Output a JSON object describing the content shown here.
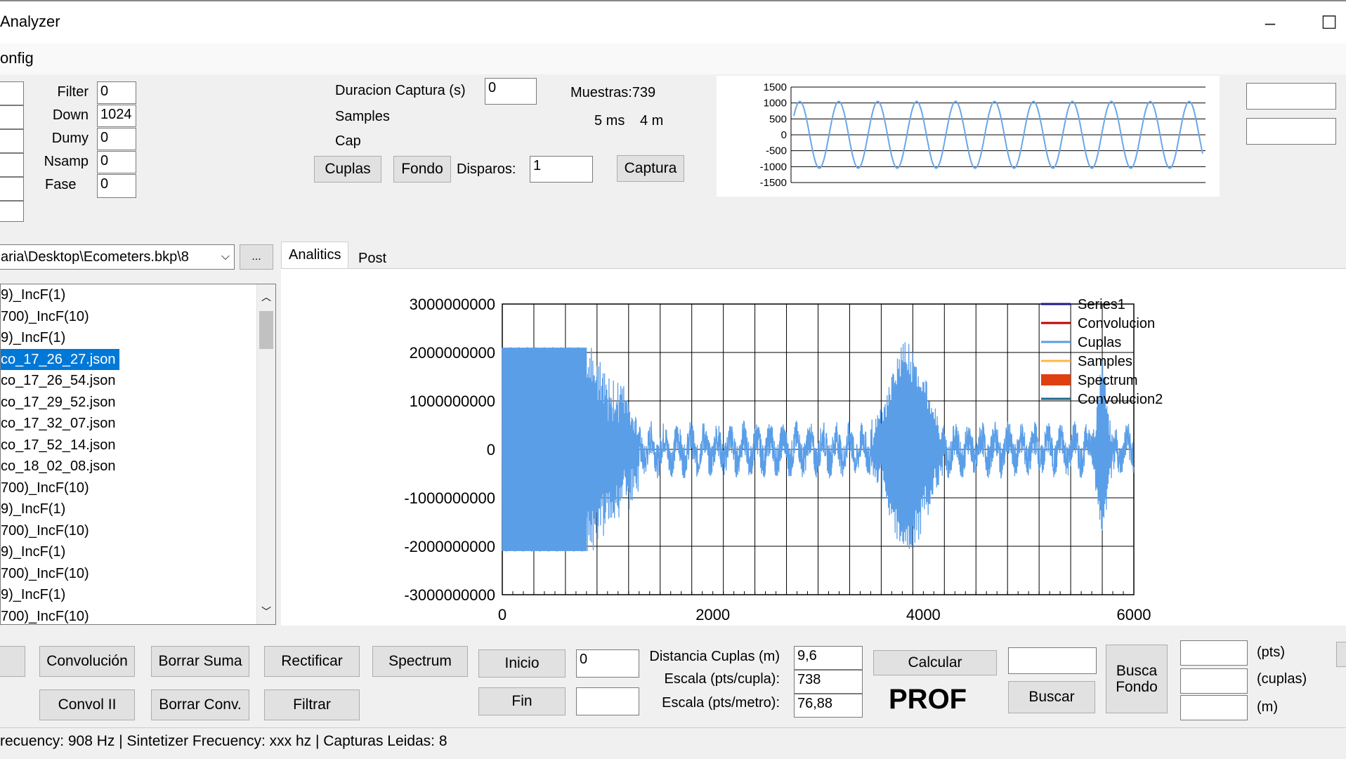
{
  "window": {
    "title": "Analyzer",
    "minimize": "–",
    "maximize": "☐"
  },
  "menu": {
    "config": "onfig"
  },
  "params": {
    "filter_label": "Filter",
    "filter": "0",
    "down_label": "Down",
    "down": "1024",
    "dumy_label": "Dumy",
    "dumy": "0",
    "nsamp_label": "Nsamp",
    "nsamp": "0",
    "fase_label": "Fase",
    "fase": "0"
  },
  "capture": {
    "duracion_label": "Duracion Captura  (s)",
    "duracion": "0",
    "samples_label": "Samples",
    "cap_label": "Cap",
    "muestras": "Muestras:739",
    "ms": "5 ms",
    "m": "4 m",
    "cuplas_btn": "Cuplas",
    "fondo_btn": "Fondo",
    "disparos_label": "Disparos:",
    "disparos": "1",
    "captura_btn": "Captura"
  },
  "mini_chart": {
    "ticks": [
      "1500",
      "1000",
      "500",
      "0",
      "-500",
      "-1000",
      "-1500"
    ],
    "color": "#6aa7e8"
  },
  "files": {
    "path": "aria\\Desktop\\Ecometers.bkp\\8",
    "browse": "...",
    "items": [
      "9)_IncF(1)",
      "700)_IncF(10)",
      "9)_IncF(1)",
      "co_17_26_27.json",
      "co_17_26_54.json",
      "co_17_29_52.json",
      "co_17_32_07.json",
      "co_17_52_14.json",
      "co_18_02_08.json",
      "700)_IncF(10)",
      "9)_IncF(1)",
      "700)_IncF(10)",
      "9)_IncF(1)",
      "700)_IncF(10)",
      "9)_IncF(1)",
      "700)_IncF(10)"
    ],
    "selected_index": 3
  },
  "tabs": {
    "analitics": "Analitics",
    "post": "Post"
  },
  "chart_data": {
    "type": "line",
    "x_ticks": [
      "0",
      "2000",
      "4000",
      "6000"
    ],
    "y_ticks": [
      "3000000000",
      "2000000000",
      "1000000000",
      "0",
      "-1000000000",
      "-2000000000",
      "-3000000000"
    ],
    "xlim": [
      0,
      6000
    ],
    "ylim": [
      -3000000000,
      3000000000
    ],
    "grid": true,
    "legend_position": "right",
    "legend": [
      {
        "name": "Series1",
        "color": "#1a1a8c",
        "kind": "line"
      },
      {
        "name": "Convolucion",
        "color": "#c00000",
        "kind": "line"
      },
      {
        "name": "Cuplas",
        "color": "#5a9ee8",
        "kind": "line"
      },
      {
        "name": "Samples",
        "color": "#ffb740",
        "kind": "line"
      },
      {
        "name": "Spectrum",
        "color": "#e04010",
        "kind": "box"
      },
      {
        "name": "Convolucion2",
        "color": "#1a6a8c",
        "kind": "line"
      }
    ]
  },
  "buttons": {
    "convolucion": "Convolución",
    "borrar_suma": "Borrar Suma",
    "rectificar": "Rectificar",
    "spectrum": "Spectrum",
    "convol_ii": "Convol II",
    "borrar_conv": "Borrar Conv.",
    "filtrar": "Filtrar",
    "inicio": "Inicio",
    "fin": "Fin",
    "calcular": "Calcular",
    "buscar": "Buscar",
    "busca_fondo": "Busca Fondo"
  },
  "inputs": {
    "inicio": "0",
    "fin": ""
  },
  "distances": {
    "distancia_label": "Distancia Cuplas (m)",
    "distancia": "9,6",
    "escala_cupla_label": "Escala (pts/cupla):",
    "escala_cupla": "738",
    "escala_metro_label": "Escala (pts/metro):",
    "escala_metro": "76,88",
    "prof": "PROF"
  },
  "units": {
    "pts": "(pts)",
    "cuplas": "(cuplas)",
    "m": "(m)"
  },
  "status": "recuency: 908 Hz  |   Sintetizer Frecuency: xxx hz   | Capturas Leidas: 8"
}
